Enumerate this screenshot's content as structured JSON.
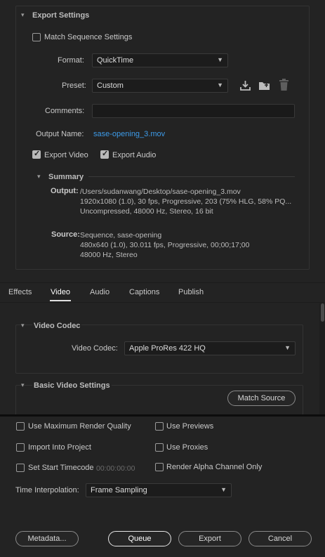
{
  "export_settings": {
    "title": "Export Settings",
    "match_sequence_label": "Match Sequence Settings",
    "format_label": "Format:",
    "format_value": "QuickTime",
    "preset_label": "Preset:",
    "preset_value": "Custom",
    "comments_label": "Comments:",
    "comments_value": "",
    "output_name_label": "Output Name:",
    "output_name_value": "sase-opening_3.mov",
    "export_video_label": "Export Video",
    "export_audio_label": "Export Audio",
    "summary_title": "Summary",
    "output_label": "Output:",
    "output_lines": [
      "/Users/sudanwang/Desktop/sase-opening_3.mov",
      "1920x1080 (1.0), 30 fps, Progressive, 203 (75% HLG, 58% PQ...",
      "Uncompressed, 48000 Hz, Stereo, 16 bit"
    ],
    "source_label": "Source:",
    "source_lines": [
      "Sequence, sase-opening",
      "480x640 (1.0), 30.011 fps, Progressive, 00;00;17;00",
      "48000 Hz, Stereo"
    ]
  },
  "tabs": [
    "Effects",
    "Video",
    "Audio",
    "Captions",
    "Publish"
  ],
  "video_codec": {
    "title": "Video Codec",
    "codec_label": "Video Codec:",
    "codec_value": "Apple ProRes 422 HQ"
  },
  "basic_video": {
    "title": "Basic Video Settings",
    "match_source_label": "Match Source"
  },
  "options": {
    "max_render_quality": "Use Maximum Render Quality",
    "use_previews": "Use Previews",
    "import_into_project": "Import Into Project",
    "use_proxies": "Use Proxies",
    "set_start_timecode": "Set Start Timecode",
    "start_timecode_value": "00:00:00:00",
    "render_alpha": "Render Alpha Channel Only",
    "time_interp_label": "Time Interpolation:",
    "time_interp_value": "Frame Sampling"
  },
  "buttons": {
    "metadata": "Metadata...",
    "queue": "Queue",
    "export": "Export",
    "cancel": "Cancel"
  },
  "colors": {
    "background": "#232323",
    "link": "#3d9be9"
  }
}
